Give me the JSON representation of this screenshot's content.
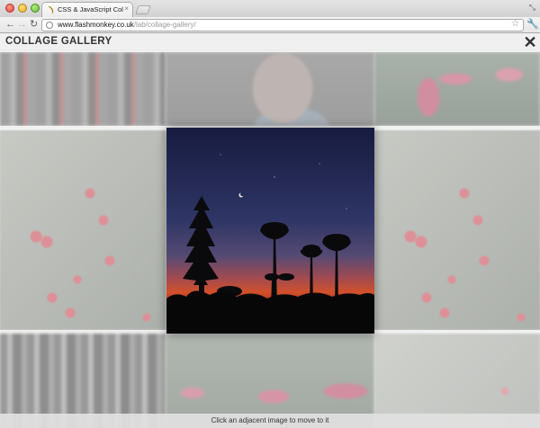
{
  "browser": {
    "tab_title": "CSS & JavaScript Collage Gallery",
    "tab_close": "×",
    "url_host": "www.flashmonkey.co.uk",
    "url_path": "/lab/collage-gallery/",
    "icons": {
      "back": "back-arrow-icon",
      "forward": "forward-arrow-icon",
      "reload": "reload-icon",
      "globe": "globe-icon",
      "star": "star-icon",
      "wrench": "wrench-icon"
    }
  },
  "gallery": {
    "title": "COLLAGE GALLERY",
    "close_symbol": "✕",
    "caption": "Click an adjacent image to move to it",
    "tiles": [
      "thumbnail-top-left",
      "thumbnail-top-center",
      "thumbnail-top-right",
      "thumbnail-middle-left",
      "featured-sunset-palms",
      "thumbnail-middle-right",
      "thumbnail-bottom-left",
      "thumbnail-bottom-center",
      "thumbnail-bottom-right"
    ]
  },
  "colors": {
    "sky_top": "#1c2048",
    "sky_mid": "#3a3f6e",
    "horizon_orange": "#d2502a",
    "horizon_red": "#8a1f1a",
    "berry": "#d9636e"
  }
}
